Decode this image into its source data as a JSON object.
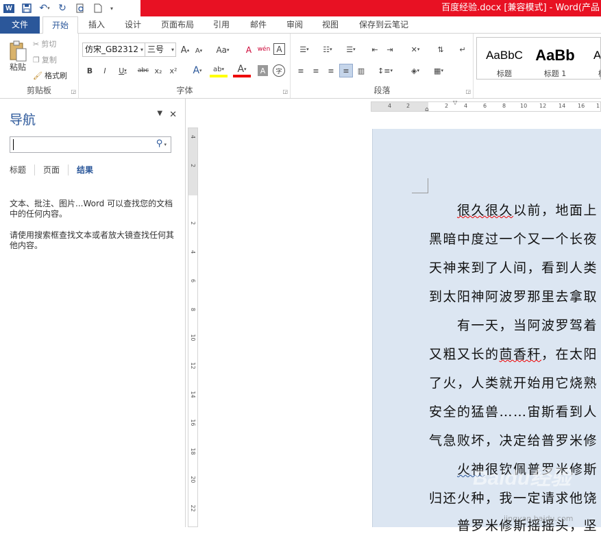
{
  "titlebar": {
    "doc_title": "百度经验.docx [兼容模式] - Word(产品"
  },
  "qat": [
    "word-icon",
    "save-icon",
    "undo-icon",
    "redo-icon",
    "print-preview-icon",
    "new-doc-icon",
    "customize-icon"
  ],
  "tabs": {
    "file": "文件",
    "home": "开始",
    "insert": "插入",
    "design": "设计",
    "layout": "页面布局",
    "references": "引用",
    "mailings": "邮件",
    "review": "审阅",
    "view": "视图",
    "cloud": "保存到云笔记"
  },
  "clipboard": {
    "paste": "粘贴",
    "cut": "剪切",
    "copy": "复制",
    "format_painter": "格式刷",
    "label": "剪贴板"
  },
  "font": {
    "name": "仿宋_GB2312",
    "size": "三号",
    "grow": "A",
    "shrink": "A",
    "case": "Aa",
    "clear": "A",
    "phonetic": "wén",
    "border": "A",
    "bold": "B",
    "italic": "I",
    "underline": "U",
    "strike": "abc",
    "sub": "x₂",
    "sup": "x²",
    "effects": "A",
    "highlight": "ab",
    "color": "A",
    "shading": "A",
    "circle": "字",
    "label": "字体"
  },
  "paragraph": {
    "label": "段落"
  },
  "styles": [
    {
      "sample": "AaBbC",
      "name": "标题"
    },
    {
      "sample": "AaBb",
      "name": "标题 1"
    },
    {
      "sample": "AaBl",
      "name": "标题"
    }
  ],
  "nav": {
    "title": "导航",
    "tabs": [
      "标题",
      "页面",
      "结果"
    ],
    "msg1": "文本、批注、图片...Word 可以查找您的文档中的任何内容。",
    "msg2": "请使用搜索框查找文本或者放大镜查找任何其他内容。"
  },
  "ruler_h": [
    "4",
    "2",
    "2",
    "4",
    "6",
    "8",
    "10",
    "12",
    "14",
    "16",
    "1"
  ],
  "ruler_v": [
    "4",
    "2",
    "2",
    "4",
    "6",
    "8",
    "10",
    "12",
    "14",
    "16",
    "18",
    "20",
    "22"
  ],
  "doc": {
    "lines": [
      "　　很久很久以前，地面上",
      "黑暗中度过一个又一个长夜",
      "天神来到了人间，看到人类",
      "到太阳神阿波罗那里去拿取",
      "　　有一天，当阿波罗驾着",
      "又粗又长的茴香秆，在太阳",
      "了火，人类就开始用它烧熟",
      "安全的猛兽……宙斯看到人",
      "气急败坏，决定给普罗米修",
      "　　火神很钦佩普罗米修斯",
      "归还火种，我一定请求他饶",
      "　　普罗米修斯摇摇头，坚"
    ]
  },
  "watermark": {
    "brand": "Baidu经验",
    "url": "jingyan.baidu.com"
  }
}
